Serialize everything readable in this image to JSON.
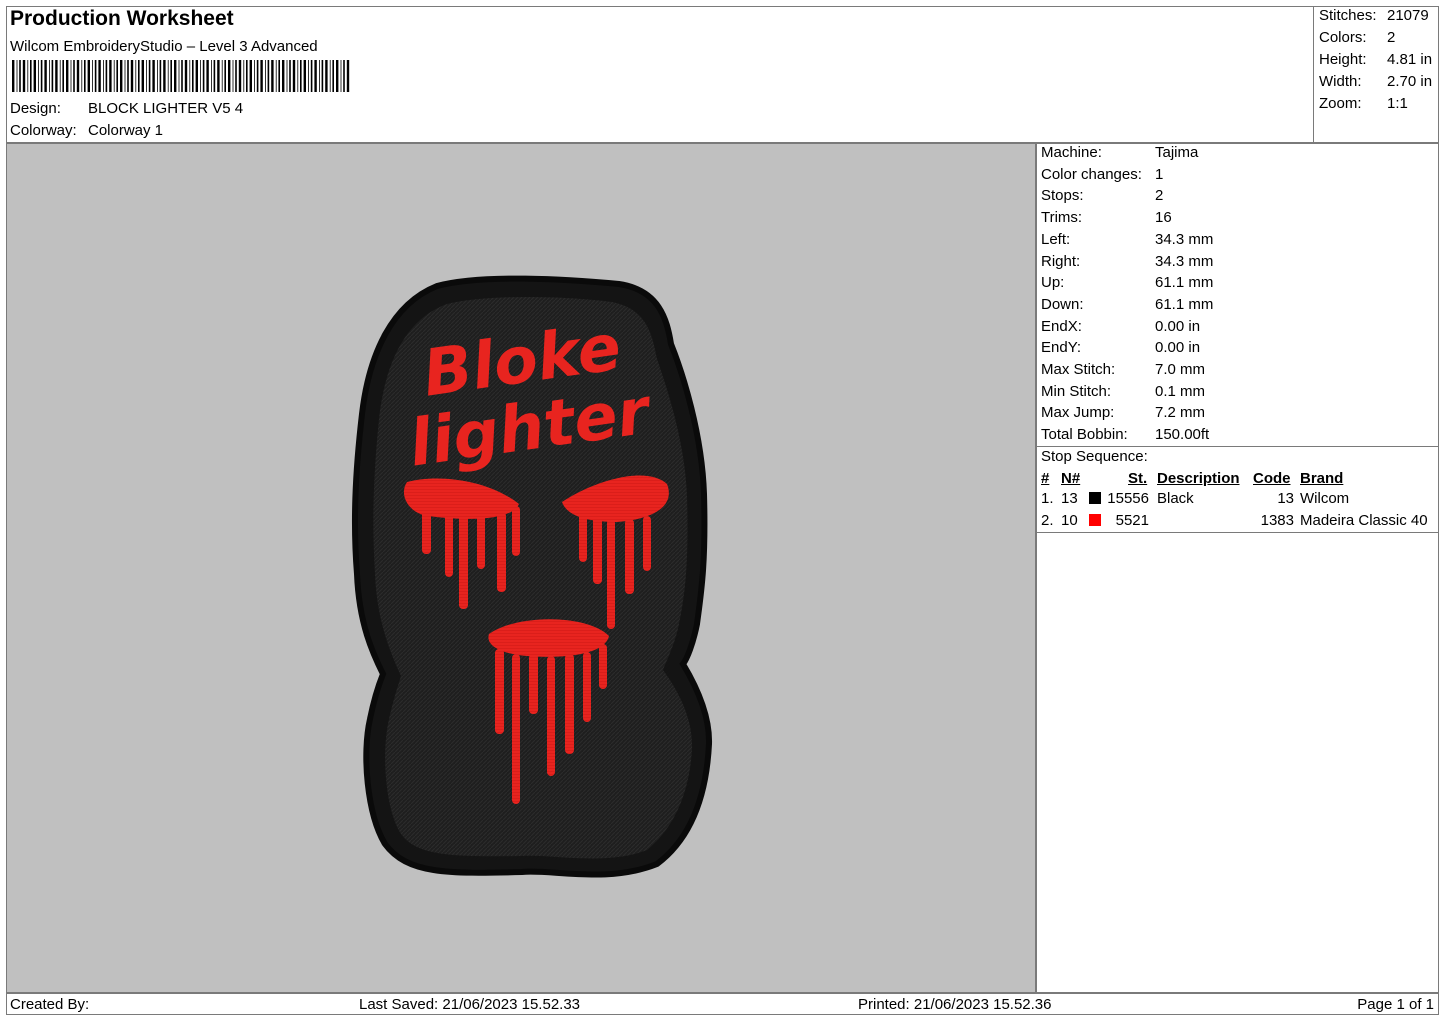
{
  "header": {
    "title": "Production Worksheet",
    "software": "Wilcom EmbroideryStudio – Level 3 Advanced",
    "design_label": "Design:",
    "design_value": "BLOCK LIGHTER V5 4",
    "colorway_label": "Colorway:",
    "colorway_value": "Colorway 1"
  },
  "summary": {
    "stitches_label": "Stitches:",
    "stitches": "21079",
    "colors_label": "Colors:",
    "colors": "2",
    "height_label": "Height:",
    "height": "4.81 in",
    "width_label": "Width:",
    "width": "2.70 in",
    "zoom_label": "Zoom:",
    "zoom": "1:1"
  },
  "machine_info": [
    {
      "label": "Machine:",
      "value": "Tajima"
    },
    {
      "label": "Color changes:",
      "value": "1"
    },
    {
      "label": "Stops:",
      "value": "2"
    },
    {
      "label": "Trims:",
      "value": "16"
    },
    {
      "label": "Left:",
      "value": "34.3 mm"
    },
    {
      "label": "Right:",
      "value": "34.3 mm"
    },
    {
      "label": "Up:",
      "value": "61.1 mm"
    },
    {
      "label": "Down:",
      "value": "61.1 mm"
    },
    {
      "label": "EndX:",
      "value": "0.00 in"
    },
    {
      "label": "EndY:",
      "value": "0.00 in"
    },
    {
      "label": "Max Stitch:",
      "value": "7.0 mm"
    },
    {
      "label": "Min Stitch:",
      "value": "0.1 mm"
    },
    {
      "label": "Max Jump:",
      "value": "7.2 mm"
    },
    {
      "label": "Total Bobbin:",
      "value": "150.00ft"
    }
  ],
  "stop_sequence": {
    "title": "Stop Sequence:",
    "headers": {
      "num": "#",
      "n": "N#",
      "st": "St.",
      "description": "Description",
      "code": "Code",
      "brand": "Brand"
    },
    "rows": [
      {
        "num": "1.",
        "n": "13",
        "color": "#000000",
        "st": "15556",
        "description": "Black",
        "code": "13",
        "brand": "Wilcom"
      },
      {
        "num": "2.",
        "n": "10",
        "color": "#ff0000",
        "st": "5521",
        "description": "",
        "code": "1383",
        "brand": "Madeira Classic 40"
      }
    ]
  },
  "design_preview": {
    "text_line1": "Bloke",
    "text_line2": "lighter",
    "patch_color": "#1c1c1c",
    "accent_color": "#e8241f",
    "background": "#c0c0c0"
  },
  "footer": {
    "created_by": "Created By:",
    "last_saved": "Last Saved: 21/06/2023 15.52.33",
    "printed": "Printed: 21/06/2023 15.52.36",
    "page": "Page 1 of 1"
  }
}
